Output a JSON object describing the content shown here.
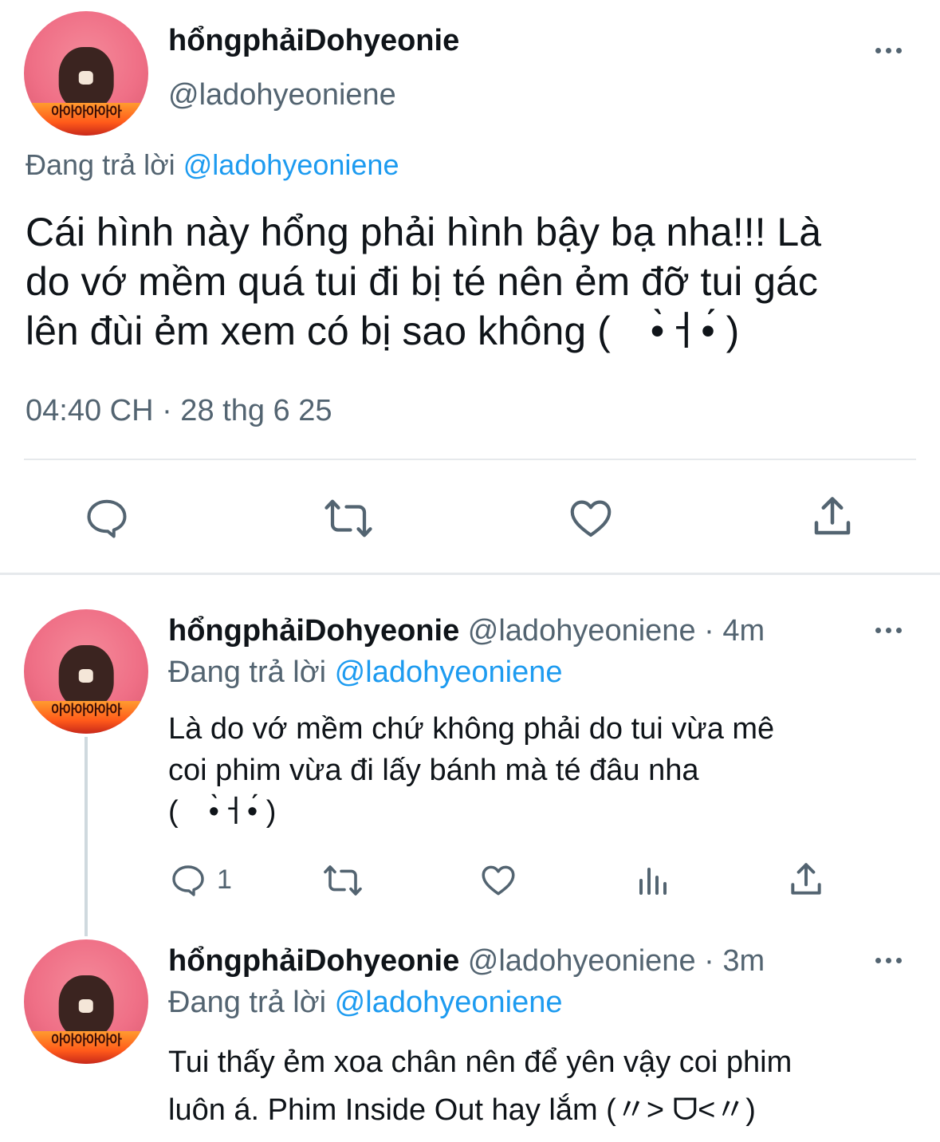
{
  "main_tweet": {
    "display_name": "hổngphảiDohyeonie",
    "handle": "@ladohyeoniene",
    "replying_to_label": "Đang trả lời",
    "replying_to_handle": "@ladohyeoniene",
    "text_line1": "Cái hình này hổng phải hình bậy bạ nha!!! Là",
    "text_line2": "do vớ mềm quá tui đi bị té nên ẻm đỡ tui gác",
    "text_line3": "lên đùi ẻm xem có bị sao không (　•̀ㅓ•́ )",
    "timestamp": "04:40 CH · 28 thg 6 25",
    "avatar_text": "아아아아아아"
  },
  "reply1": {
    "display_name": "hổngphảiDohyeonie",
    "handle": "@ladohyeoniene",
    "time": " · 4m",
    "replying_to_label": "Đang trả lời",
    "replying_to_handle": "@ladohyeoniene",
    "text_line1": "Là do vớ mềm chứ không phải do tui vừa mê",
    "text_line2": "coi phim vừa đi lấy bánh mà té đâu nha",
    "text_line3": "(　•̀ㅓ•́ )",
    "reply_count": "1",
    "avatar_text": "아아아아아아"
  },
  "reply2": {
    "display_name": "hổngphảiDohyeonie",
    "handle": "@ladohyeoniene",
    "time": " · 3m",
    "replying_to_label": "Đang trả lời",
    "replying_to_handle": "@ladohyeoniene",
    "text_line1": "Tui thấy ẻm xoa chân nên để yên vậy coi phim",
    "text_line2": "luôn á. Phim Inside Out hay lắm (〃> ᗜ<〃)",
    "avatar_text": "아아아아아아"
  },
  "colors": {
    "accent": "#1d9bf0",
    "secondary_text": "#536471",
    "divider": "#e6e9ec"
  }
}
